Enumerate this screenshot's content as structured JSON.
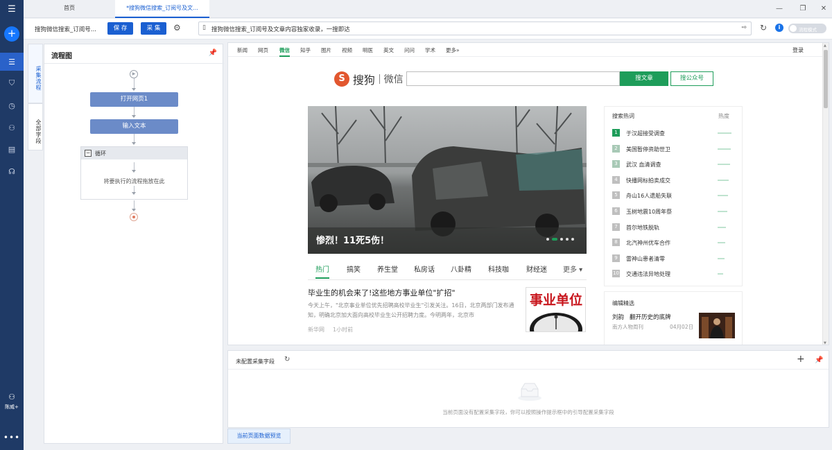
{
  "sidebar": {
    "top_icon": "☰",
    "plus": "+",
    "items": [
      {
        "name": "menu-icon",
        "glyph": "☰",
        "active": true
      },
      {
        "name": "filter-icon",
        "glyph": "⛉"
      },
      {
        "name": "clock-icon",
        "glyph": "◷"
      },
      {
        "name": "people-icon",
        "glyph": "⚇"
      },
      {
        "name": "document-icon",
        "glyph": "▤"
      },
      {
        "name": "headset-icon",
        "glyph": "☊"
      }
    ],
    "user_icon": "⚇",
    "user_name": "陈威+",
    "more": "•••"
  },
  "tabs": {
    "home": "首页",
    "current": "*搜狗微信搜索_订阅号及文..."
  },
  "window": {
    "minimize": "—",
    "restore": "❐",
    "close": "✕"
  },
  "toolbar": {
    "task_name": "搜狗微信搜索_订阅号...",
    "save_label": "保 存",
    "collect_label": "采 集",
    "gear": "⚙",
    "url_text": "搜狗微信搜索_订阅号及文章内容独家收录，一搜即达",
    "doc_icon": "▯",
    "go_icon": "⇨",
    "refresh": "↻",
    "info": "i",
    "toggle_label": "流程模式"
  },
  "side_tabs": {
    "flow": "采集流程",
    "fields": "全部字段"
  },
  "flow": {
    "title": "流程图",
    "pin": "📌",
    "start_icon": "▶",
    "node1": "打开网页1",
    "node2": "输入文本",
    "loop_minus": "−",
    "loop_label": "循环",
    "loop_hint": "将要执行的流程拖放在此"
  },
  "page": {
    "nav": [
      "新闻",
      "网页",
      "微信",
      "知乎",
      "图片",
      "视频",
      "明医",
      "英文",
      "问问",
      "学术",
      "更多»"
    ],
    "nav_active_index": 2,
    "login": "登录",
    "logo_s": "S",
    "logo_sogou": "搜狗",
    "logo_weixin": "微信",
    "search_btn": "搜文章",
    "search_btn2": "搜公众号",
    "hero_caption": "惨烈！11死5伤！",
    "cats": [
      "热门",
      "搞笑",
      "养生堂",
      "私房话",
      "八卦精",
      "科技咖",
      "财经迷",
      "更多 ▾"
    ],
    "news_title": "毕业生的机会来了!这些地方事业单位\"扩招\"",
    "news_desc": "今天上午，\"北京事业单位优先招聘高校毕业生\"引发关注。16日，北京两部门发布通知，明确北京加大面向高校毕业生公开招聘力度。今明两年，北京市",
    "news_source": "新华网",
    "news_time": "1小时前",
    "news_thumb_text": "事业单位",
    "hot_title": "搜索热词",
    "hot_label": "热度",
    "hot": [
      {
        "n": "1",
        "t": "于汉超接受调查",
        "heat": 0.92
      },
      {
        "n": "2",
        "t": "美国暂停资助世卫",
        "heat": 0.86
      },
      {
        "n": "3",
        "t": "武汉 血清调查",
        "heat": 0.8
      },
      {
        "n": "4",
        "t": "快播网标拍卖成交",
        "heat": 0.74
      },
      {
        "n": "5",
        "t": "舟山16人遗船失联",
        "heat": 0.68
      },
      {
        "n": "6",
        "t": "玉树地震10周年祭",
        "heat": 0.62
      },
      {
        "n": "7",
        "t": "首尔地铁脱轨",
        "heat": 0.56
      },
      {
        "n": "8",
        "t": "北汽神州优车合作",
        "heat": 0.5
      },
      {
        "n": "9",
        "t": "雷神山患者清零",
        "heat": 0.44
      },
      {
        "n": "10",
        "t": "交通违法异地处理",
        "heat": 0.36
      }
    ],
    "edit_title": "编辑精选",
    "edit_item_a": "刘韵",
    "edit_item_b": "翻开历史的底牌",
    "edit_source": "南方人物周刊",
    "edit_date": "04月02日"
  },
  "fields": {
    "title": "未配置采集字段",
    "refresh": "↻",
    "plus": "+",
    "pin": "📌",
    "empty_text": "当前页面没有配置采集字段，你可以按照操作提示框中的引导配置采集字段"
  },
  "preview_tab": "当前页面数据预览"
}
